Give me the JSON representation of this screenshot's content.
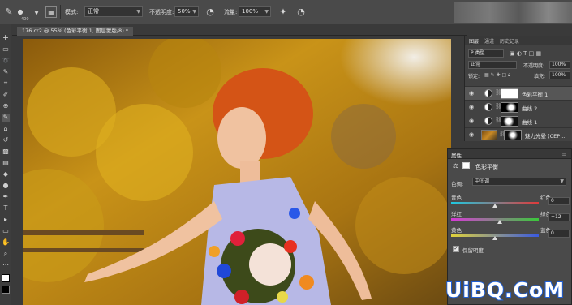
{
  "options_bar": {
    "brush_size": "400",
    "mode_label": "模式:",
    "mode_value": "正常",
    "opacity_label": "不透明度:",
    "opacity_value": "50%",
    "flow_label": "流量:",
    "flow_value": "100%"
  },
  "document_tab": {
    "title": "176.cr2 @ 55% (色彩平衡 1, 图层蒙版/8) *"
  },
  "layers_panel": {
    "tabs": [
      "图层",
      "通道",
      "历史记录"
    ],
    "filter_kind": "P 类型",
    "blend_mode": "正常",
    "opacity_label": "不透明度:",
    "opacity_value": "100%",
    "lock_label": "锁定:",
    "fill_label": "填充:",
    "fill_value": "100%",
    "layers": [
      {
        "name": "色彩平衡 1",
        "selected": true
      },
      {
        "name": "曲线 2",
        "selected": false
      },
      {
        "name": "曲线 1",
        "selected": false
      },
      {
        "name": "魅力光晕 (CEP ...",
        "selected": false
      }
    ]
  },
  "properties_panel": {
    "title": "属性",
    "adjustment_name": "色彩平衡",
    "tone_label": "色调:",
    "tone_value": "中间调",
    "sliders": [
      {
        "left": "青色",
        "right": "红色",
        "value": "0",
        "position": 0.5
      },
      {
        "left": "洋红",
        "right": "绿色",
        "value": "+12",
        "position": 0.56
      },
      {
        "left": "黄色",
        "right": "蓝色",
        "value": "0",
        "position": 0.5
      }
    ],
    "preserve_luminosity_label": "保留明度",
    "preserve_luminosity_checked": true
  },
  "watermark": {
    "text": "UiBQ.CoM"
  },
  "colors": {
    "panel_bg": "#424242",
    "accent_cyan_red": [
      "#1ec8e0",
      "#e03a3a"
    ],
    "accent_magenta_green": [
      "#d63ad6",
      "#3ac83a"
    ],
    "accent_yellow_blue": [
      "#e0d23a",
      "#3a5ae0"
    ]
  }
}
